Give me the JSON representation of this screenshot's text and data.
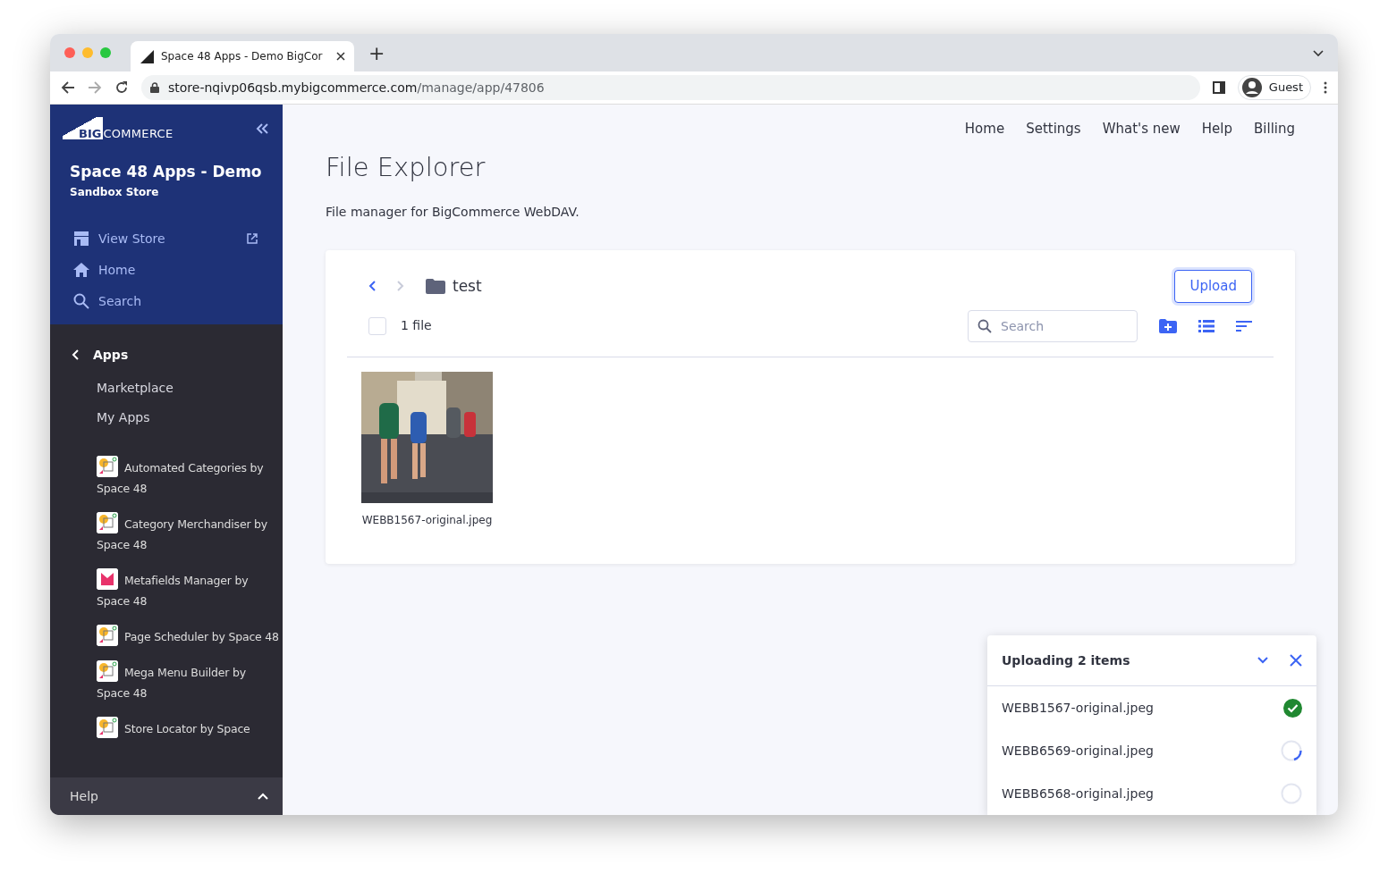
{
  "browser": {
    "tab_title": "Space 48 Apps - Demo BigCor",
    "new_tab": "+",
    "url_host": "store-nqivp06qsb.mybigcommerce.com",
    "url_path": "/manage/app/47806",
    "profile": "Guest"
  },
  "sidebar": {
    "logo_mark": "BIG",
    "logo": "COMMERCE",
    "store_name": "Space 48 Apps - Demo",
    "store_type": "Sandbox Store",
    "nav": [
      {
        "label": "View Store",
        "kind": "store"
      },
      {
        "label": "Home",
        "kind": "home"
      },
      {
        "label": "Search",
        "kind": "search"
      }
    ],
    "section": "Apps",
    "links": [
      "Marketplace",
      "My Apps"
    ],
    "apps": [
      {
        "label": "Automated Categories by Space 48",
        "kind": "sheet"
      },
      {
        "label": "Category Merchandiser by Space 48",
        "kind": "sheet"
      },
      {
        "label": "Metafields Manager by Space 48",
        "kind": "meta"
      },
      {
        "label": "Page Scheduler by Space 48",
        "kind": "sheet"
      },
      {
        "label": "Mega Menu Builder by Space 48",
        "kind": "sheet"
      },
      {
        "label": "Store Locator by Space",
        "kind": "sheet"
      }
    ],
    "footer": "Help"
  },
  "top_nav": [
    "Home",
    "Settings",
    "What's new",
    "Help",
    "Billing"
  ],
  "page": {
    "title": "File Explorer",
    "subtitle": "File manager for BigCommerce WebDAV."
  },
  "explorer": {
    "folder": "test",
    "upload_button": "Upload",
    "select_all": {
      "checked": false
    },
    "count": "1 file",
    "search": {
      "placeholder": "Search"
    },
    "files": [
      {
        "name": "WEBB1567-original.jpeg",
        "kind": "picture"
      }
    ]
  },
  "uploads": {
    "title": "Uploading 2 items",
    "items": [
      {
        "name": "WEBB1567-original.jpeg",
        "complete": true,
        "in_progress": false
      },
      {
        "name": "WEBB6569-original.jpeg",
        "complete": false,
        "in_progress": true
      },
      {
        "name": "WEBB6568-original.jpeg",
        "complete": false,
        "in_progress": false
      }
    ]
  }
}
